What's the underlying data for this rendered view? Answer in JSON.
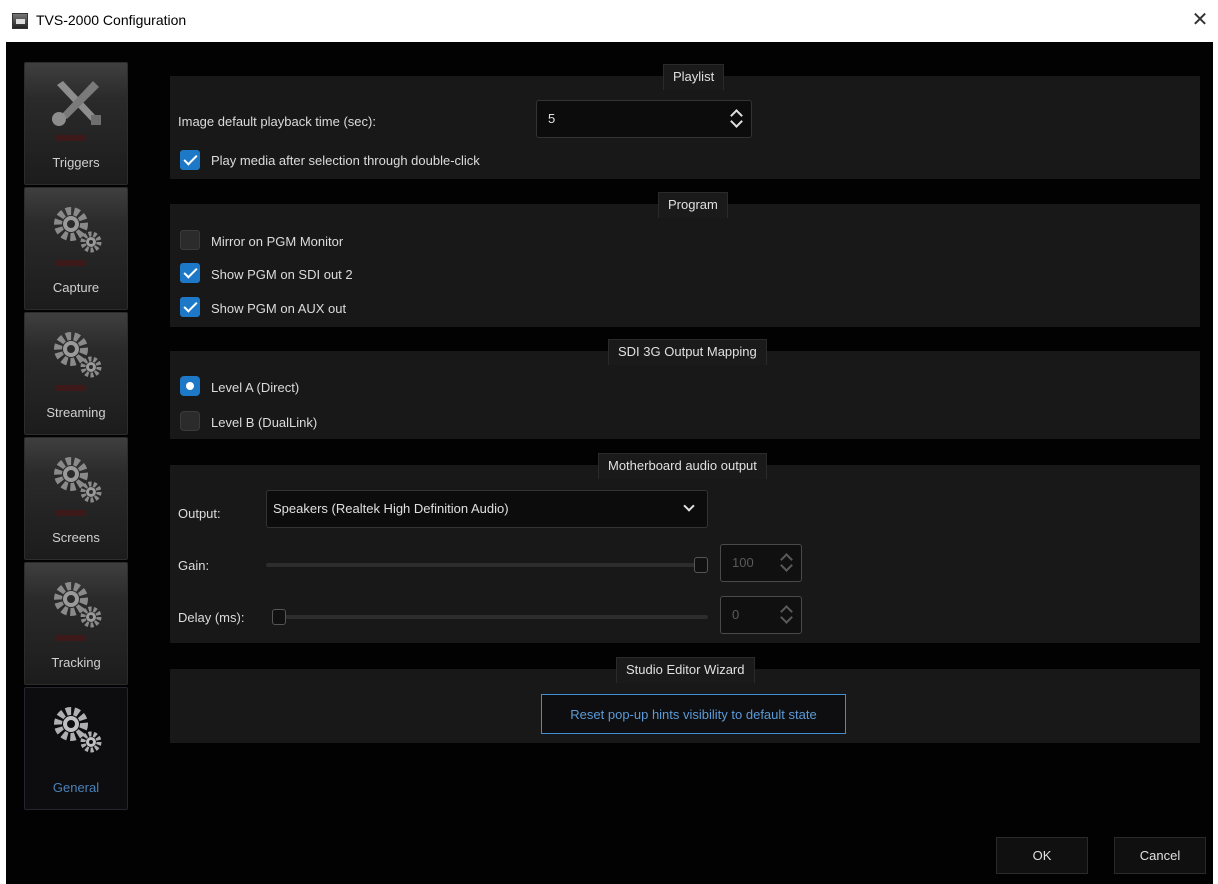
{
  "window": {
    "title": "TVS-2000 Configuration"
  },
  "sidebar": {
    "items": [
      {
        "label": "Triggers",
        "icon": "tools-icon"
      },
      {
        "label": "Capture",
        "icon": "gears-icon"
      },
      {
        "label": "Streaming",
        "icon": "gears-icon"
      },
      {
        "label": "Screens",
        "icon": "gears-icon"
      },
      {
        "label": "Tracking",
        "icon": "gears-icon"
      },
      {
        "label": "General",
        "icon": "gears-icon",
        "active": true
      }
    ]
  },
  "playlist": {
    "title": "Playlist",
    "playback_time_label": "Image default playback time (sec):",
    "playback_time_value": "5",
    "play_on_dblclick_label": "Play media after selection through double-click",
    "play_on_dblclick_checked": true
  },
  "program": {
    "title": "Program",
    "mirror_label": "Mirror on PGM Monitor",
    "mirror_checked": false,
    "sdi_out2_label": "Show PGM on SDI out 2",
    "sdi_out2_checked": true,
    "aux_out_label": "Show PGM on AUX out",
    "aux_out_checked": true
  },
  "sdi_mapping": {
    "title": "SDI 3G Output Mapping",
    "level_a_label": "Level A (Direct)",
    "level_b_label": "Level B (DualLink)",
    "selected": "level_a"
  },
  "audio": {
    "title": "Motherboard audio output",
    "output_label": "Output:",
    "output_value": "Speakers (Realtek High Definition Audio)",
    "gain_label": "Gain:",
    "gain_value": "100",
    "gain_fraction": 1.0,
    "delay_label": "Delay (ms):",
    "delay_value": "0",
    "delay_fraction": 0.0
  },
  "wizard": {
    "title": "Studio Editor Wizard",
    "reset_button_label": "Reset pop-up hints visibility to default state"
  },
  "footer": {
    "ok_label": "OK",
    "cancel_label": "Cancel"
  },
  "colors": {
    "accent": "#1e78c8",
    "background": "#020202",
    "panel": "#181818"
  }
}
